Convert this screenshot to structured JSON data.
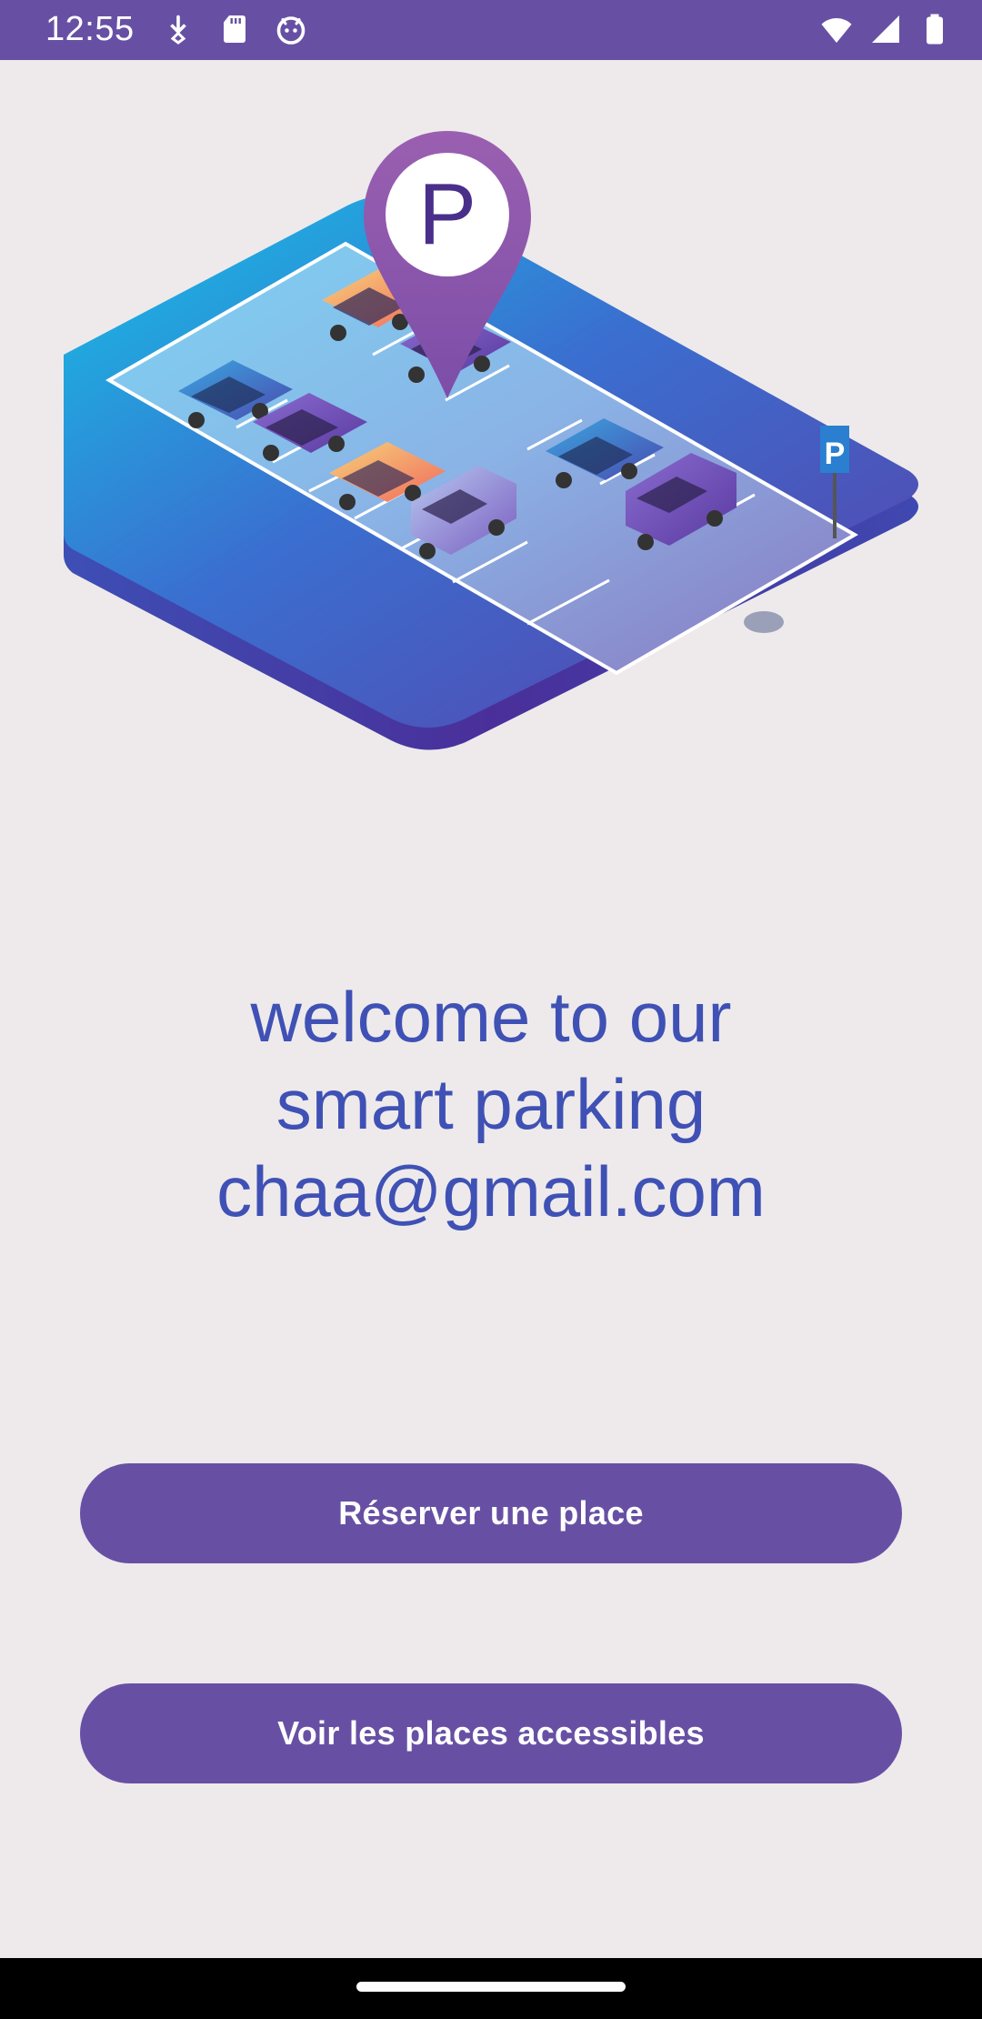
{
  "status_bar": {
    "time": "12:55",
    "left_icons": [
      "download-icon",
      "sd-card-icon",
      "android-debug-icon"
    ],
    "right_icons": [
      "wifi-icon",
      "signal-icon",
      "battery-icon"
    ],
    "background_color": "#6750a4"
  },
  "hero": {
    "pin_letter": "P",
    "sign_letter": "P"
  },
  "welcome": {
    "line1": "welcome to our",
    "line2": "smart parking",
    "email": "chaa@gmail.com",
    "color": "#3f51b5"
  },
  "buttons": {
    "reserve_label": "Réserver une place",
    "view_label": "Voir les places accessibles",
    "color": "#6750a4"
  },
  "colors": {
    "background": "#eeeaeb",
    "accent": "#6750a4"
  }
}
